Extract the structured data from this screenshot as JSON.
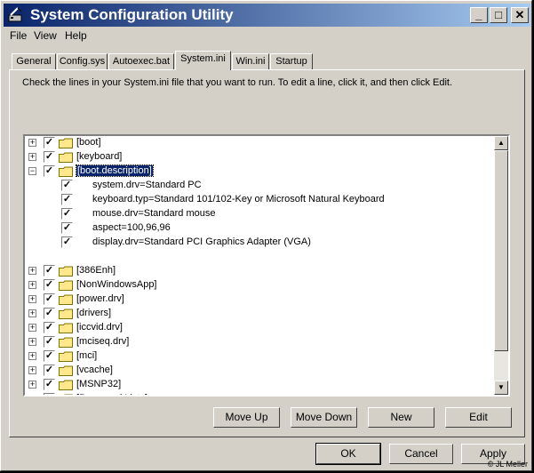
{
  "window": {
    "title": "System Configuration Utility"
  },
  "menu": [
    {
      "label": "File"
    },
    {
      "label": "View"
    },
    {
      "label": "Help"
    }
  ],
  "tabs": [
    {
      "label": "General"
    },
    {
      "label": "Config.sys"
    },
    {
      "label": "Autoexec.bat"
    },
    {
      "label": "System.ini",
      "active": true
    },
    {
      "label": "Win.ini"
    },
    {
      "label": "Startup"
    }
  ],
  "instructions": "Check the lines in your System.ini file that you want to run. To edit a line, click it, and then click Edit.",
  "tree": [
    {
      "label": "[boot]",
      "expander": "+",
      "checked": true,
      "folder": true
    },
    {
      "label": "[keyboard]",
      "expander": "+",
      "checked": true,
      "folder": true
    },
    {
      "label": "[boot.description]",
      "expander": "−",
      "checked": true,
      "folder": true,
      "selected": true
    },
    {
      "label": "system.drv=Standard PC",
      "checked": true,
      "child": true
    },
    {
      "label": "keyboard.typ=Standard 101/102-Key or Microsoft Natural Keyboard",
      "checked": true,
      "child": true
    },
    {
      "label": "mouse.drv=Standard mouse",
      "checked": true,
      "child": true
    },
    {
      "label": "aspect=100,96,96",
      "checked": true,
      "child": true
    },
    {
      "label": "display.drv=Standard PCI Graphics Adapter (VGA)",
      "checked": true,
      "child": true
    },
    {
      "label": "",
      "blank": true
    },
    {
      "label": "[386Enh]",
      "expander": "+",
      "checked": true,
      "folder": true
    },
    {
      "label": "[NonWindowsApp]",
      "expander": "+",
      "checked": true,
      "folder": true
    },
    {
      "label": "[power.drv]",
      "expander": "+",
      "checked": true,
      "folder": true
    },
    {
      "label": "[drivers]",
      "expander": "+",
      "checked": true,
      "folder": true
    },
    {
      "label": "[iccvid.drv]",
      "expander": "+",
      "checked": true,
      "folder": true
    },
    {
      "label": "[mciseq.drv]",
      "expander": "+",
      "checked": true,
      "folder": true
    },
    {
      "label": "[mci]",
      "expander": "+",
      "checked": true,
      "folder": true
    },
    {
      "label": "[vcache]",
      "expander": "+",
      "checked": true,
      "folder": true
    },
    {
      "label": "[MSNP32]",
      "expander": "+",
      "checked": true,
      "folder": true
    },
    {
      "label": "[Password Lists]",
      "expander": "+",
      "checked": true,
      "folder": true
    }
  ],
  "buttons": {
    "move_up": "Move Up",
    "move_down": "Move Down",
    "new": "New",
    "edit": "Edit",
    "ok": "OK",
    "cancel": "Cancel",
    "apply": "Apply"
  },
  "titlebar_buttons": {
    "minimize": "_",
    "maximize": "□",
    "close": "✕"
  },
  "copyright": "© JL Meller",
  "colors": {
    "titlebar_start": "#0a246a",
    "titlebar_end": "#a6caf0",
    "face": "#d4d0c8",
    "selection": "#0a246a"
  }
}
